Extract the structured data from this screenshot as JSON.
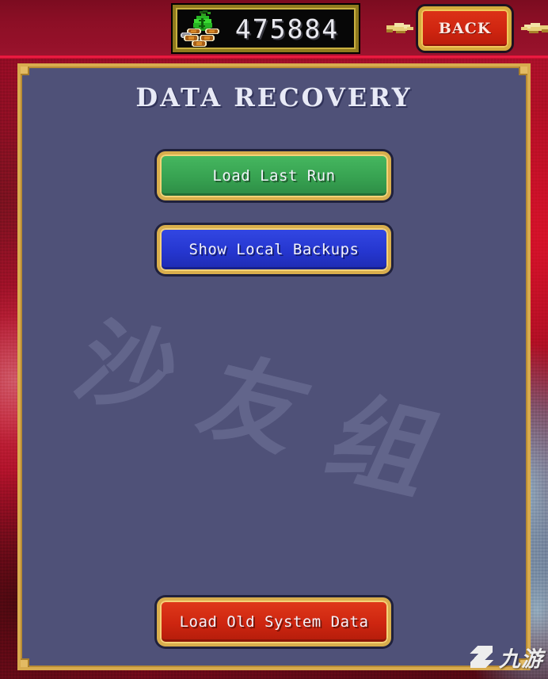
{
  "window": {
    "title": "Data Recovery"
  },
  "topbar": {
    "currency": {
      "icon": "money-bag-coins-icon",
      "value": "475884"
    },
    "back_button": {
      "label": "BACK",
      "left_decoration_icon": "arrow-right-icon",
      "right_decoration_icon": "arrow-left-icon"
    }
  },
  "panel": {
    "title": "DATA RECOVERY",
    "watermark": {
      "chars": [
        "沙",
        "友",
        "组"
      ]
    },
    "buttons": [
      {
        "id": "load-last-run",
        "label": "Load Last Run",
        "color": "#37a251"
      },
      {
        "id": "show-local-backups",
        "label": "Show Local Backups",
        "color": "#2536cf"
      },
      {
        "id": "load-old-system-data",
        "label": "Load Old System Data",
        "color": "#cd2510"
      }
    ]
  },
  "site_logo": {
    "mark": "jiuyou-logo-icon",
    "text": "九游"
  },
  "colors": {
    "panel_background": "#4f5178",
    "panel_border_gold": "#d8ab4e",
    "topbar_red": "#8d0f26",
    "accent_rule": "#f3204a",
    "green_button": "#37a251",
    "blue_button": "#2536cf",
    "red_button": "#cd2510",
    "title_text": "#e8eaf6"
  }
}
